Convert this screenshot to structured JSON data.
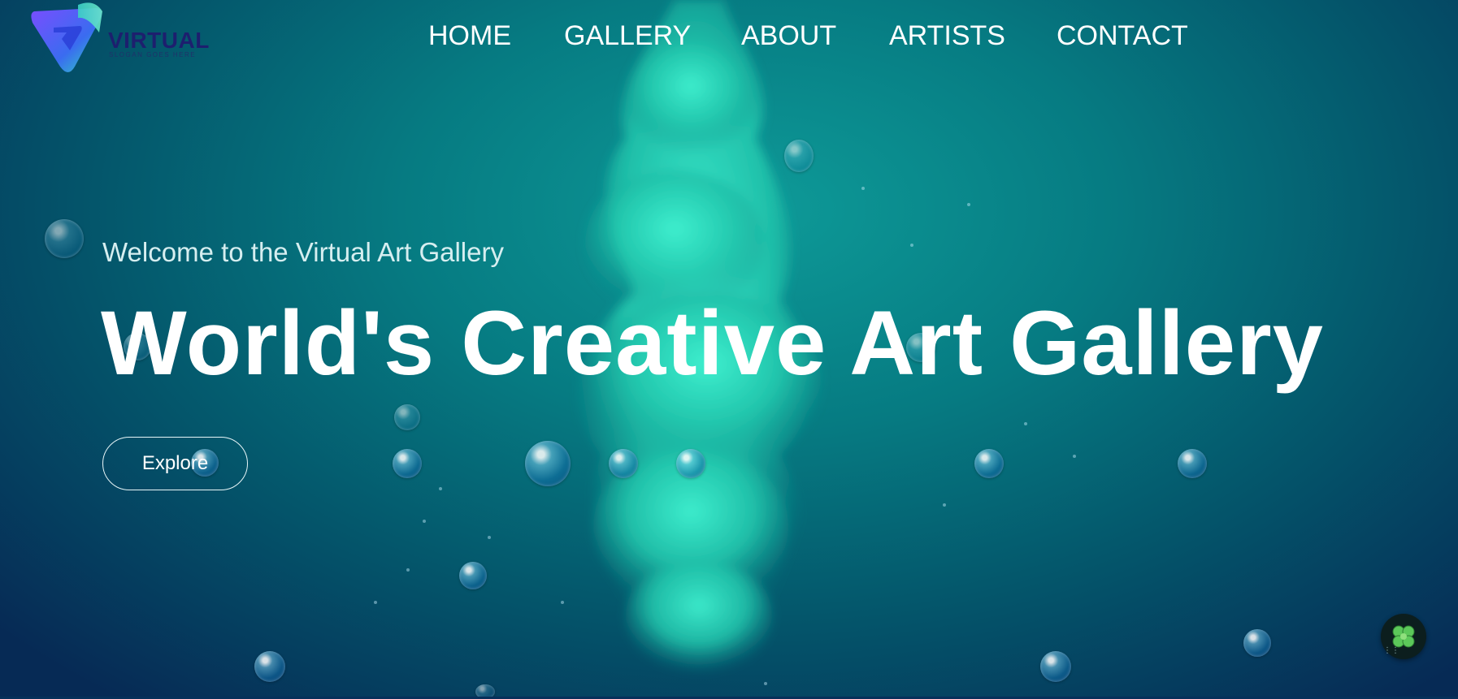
{
  "brand": {
    "name": "VIRTUAL",
    "slogan": "SLOGAN GOES HERE",
    "logo_icon": "v-shape-logo-icon"
  },
  "nav": {
    "items": [
      {
        "label": "HOME"
      },
      {
        "label": "GALLERY"
      },
      {
        "label": "ABOUT"
      },
      {
        "label": "ARTISTS"
      },
      {
        "label": "CONTACT"
      }
    ]
  },
  "hero": {
    "welcome": "Welcome to the Virtual Art Gallery",
    "headline": "World's Creative Art Gallery",
    "explore_label": "Explore"
  },
  "widget": {
    "icon": "clover-icon"
  },
  "colors": {
    "background_top": "#0e9a98",
    "background_bottom": "#062a55",
    "smoke": "#2fd6b8",
    "text": "#ffffff",
    "logo_text": "#1d1f6e"
  }
}
